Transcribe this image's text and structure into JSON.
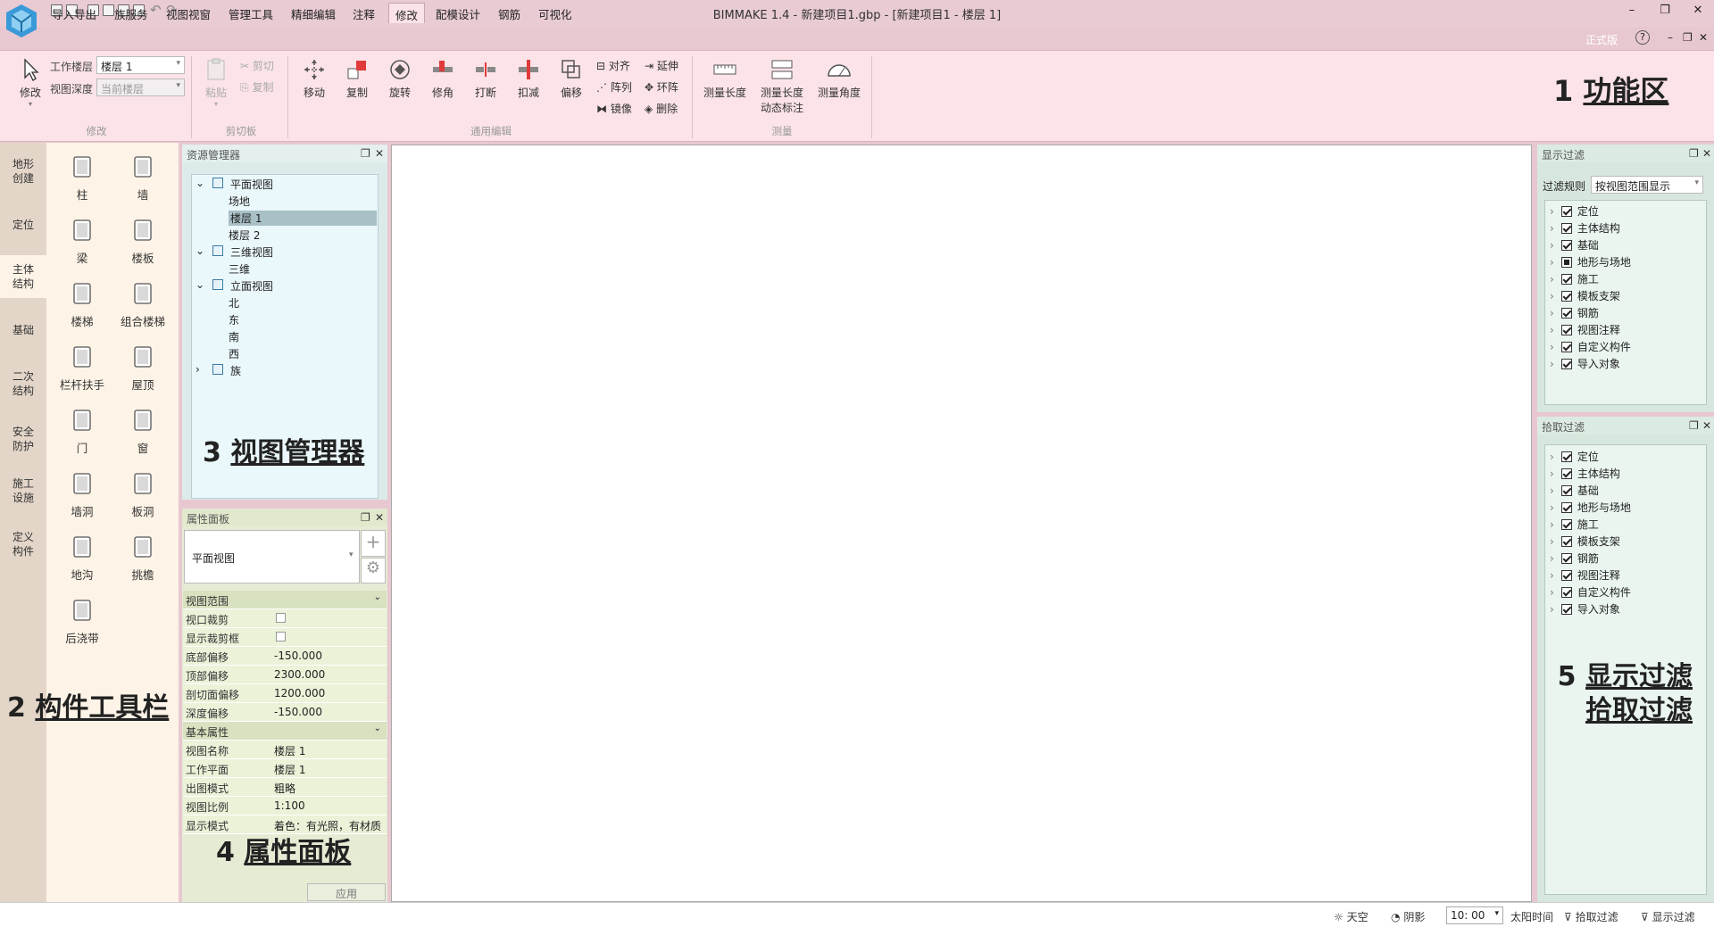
{
  "title": "BIMMAKE 1.4 - 新建项目1.gbp - [新建项目1 - 楼层 1]",
  "menu": [
    "导入导出",
    "族服务",
    "视图视窗",
    "管理工具",
    "精细编辑",
    "注释",
    "修改",
    "配模设计",
    "钢筋",
    "可视化"
  ],
  "menu_active_index": 6,
  "menu_right": {
    "edition": "正式版",
    "help": "?"
  },
  "ribbon": {
    "modify_label": "修改",
    "work_floor_label": "工作楼层",
    "work_floor_value": "楼层 1",
    "view_depth_label": "视图深度",
    "view_depth_value": "当前楼层",
    "group_modify": "修改",
    "paste": "粘贴",
    "cut": "剪切",
    "copy_small": "复制",
    "group_clipboard": "剪切板",
    "move": "移动",
    "copy": "复制",
    "rotate": "旋转",
    "trim": "修角",
    "break": "打断",
    "deduct": "扣减",
    "offset": "偏移",
    "align": "对齐",
    "array": "阵列",
    "mirror": "镜像",
    "extend": "延伸",
    "ring_array": "环阵",
    "delete": "删除",
    "group_edit": "通用编辑",
    "measure_length": "测量长度",
    "measure_dynamic_1": "测量长度",
    "measure_dynamic_2": "动态标注",
    "measure_angle": "测量角度",
    "group_measure": "测量"
  },
  "annotations": {
    "a1_num": "1",
    "a1_text": "功能区",
    "a2_num": "2",
    "a2_text": "构件工具栏",
    "a3_num": "3",
    "a3_text": "视图管理器",
    "a4_num": "4",
    "a4_text": "属性面板",
    "a5_num": "5",
    "a5_text1": "显示过滤",
    "a5_text2": "拾取过滤"
  },
  "categories": [
    [
      "地形",
      "创建"
    ],
    [
      "定位"
    ],
    [
      "主体",
      "结构"
    ],
    [
      "基础"
    ],
    [
      "二次",
      "结构"
    ],
    [
      "安全",
      "防护"
    ],
    [
      "施工",
      "设施"
    ],
    [
      "定义",
      "构件"
    ]
  ],
  "categories_active_index": 2,
  "tools": [
    "柱",
    "墙",
    "梁",
    "楼板",
    "楼梯",
    "组合楼梯",
    "栏杆扶手",
    "屋顶",
    "门",
    "窗",
    "墙洞",
    "板洞",
    "地沟",
    "挑檐",
    "后浇带"
  ],
  "asset_manager": {
    "title": "资源管理器",
    "tree": [
      {
        "label": "平面视图",
        "level": 0,
        "expand": "v"
      },
      {
        "label": "场地",
        "level": 1
      },
      {
        "label": "楼层 1",
        "level": 1,
        "selected": true
      },
      {
        "label": "楼层 2",
        "level": 1
      },
      {
        "label": "三维视图",
        "level": 0,
        "expand": "v"
      },
      {
        "label": "三维",
        "level": 1
      },
      {
        "label": "立面视图",
        "level": 0,
        "expand": "v"
      },
      {
        "label": "北",
        "level": 1
      },
      {
        "label": "东",
        "level": 1
      },
      {
        "label": "南",
        "level": 1
      },
      {
        "label": "西",
        "level": 1
      },
      {
        "label": "族",
        "level": 0,
        "expand": ">"
      }
    ]
  },
  "properties": {
    "title": "属性面板",
    "type_value": "平面视图",
    "section1": "视图范围",
    "rows1": [
      {
        "k": "视口裁剪",
        "v": "",
        "checkbox": true
      },
      {
        "k": "显示裁剪框",
        "v": "",
        "checkbox": true
      },
      {
        "k": "底部偏移",
        "v": "-150.000"
      },
      {
        "k": "顶部偏移",
        "v": "2300.000"
      },
      {
        "k": "剖切面偏移",
        "v": "1200.000"
      },
      {
        "k": "深度偏移",
        "v": "-150.000"
      }
    ],
    "section2": "基本属性",
    "rows2": [
      {
        "k": "视图名称",
        "v": "楼层 1"
      },
      {
        "k": "工作平面",
        "v": "楼层 1"
      },
      {
        "k": "出图模式",
        "v": "粗略"
      },
      {
        "k": "视图比例",
        "v": "1:100"
      },
      {
        "k": "显示模式",
        "v": "着色：有光照，有材质"
      }
    ],
    "apply": "应用"
  },
  "display_filter": {
    "title": "显示过滤",
    "rule_label": "过滤规则",
    "rule_value": "按视图范围显示",
    "items": [
      "定位",
      "主体结构",
      "基础",
      "地形与场地",
      "施工",
      "模板支架",
      "钢筋",
      "视图注释",
      "自定义构件",
      "导入对象"
    ],
    "partial_index": 3
  },
  "pick_filter": {
    "title": "拾取过滤",
    "items": [
      "定位",
      "主体结构",
      "基础",
      "地形与场地",
      "施工",
      "模板支架",
      "钢筋",
      "视图注释",
      "自定义构件",
      "导入对象"
    ]
  },
  "status": {
    "sky": "天空",
    "shadow": "阴影",
    "time": "10: 00",
    "sun_time": "太阳时间",
    "pick_filter": "拾取过滤",
    "display_filter": "显示过滤"
  }
}
